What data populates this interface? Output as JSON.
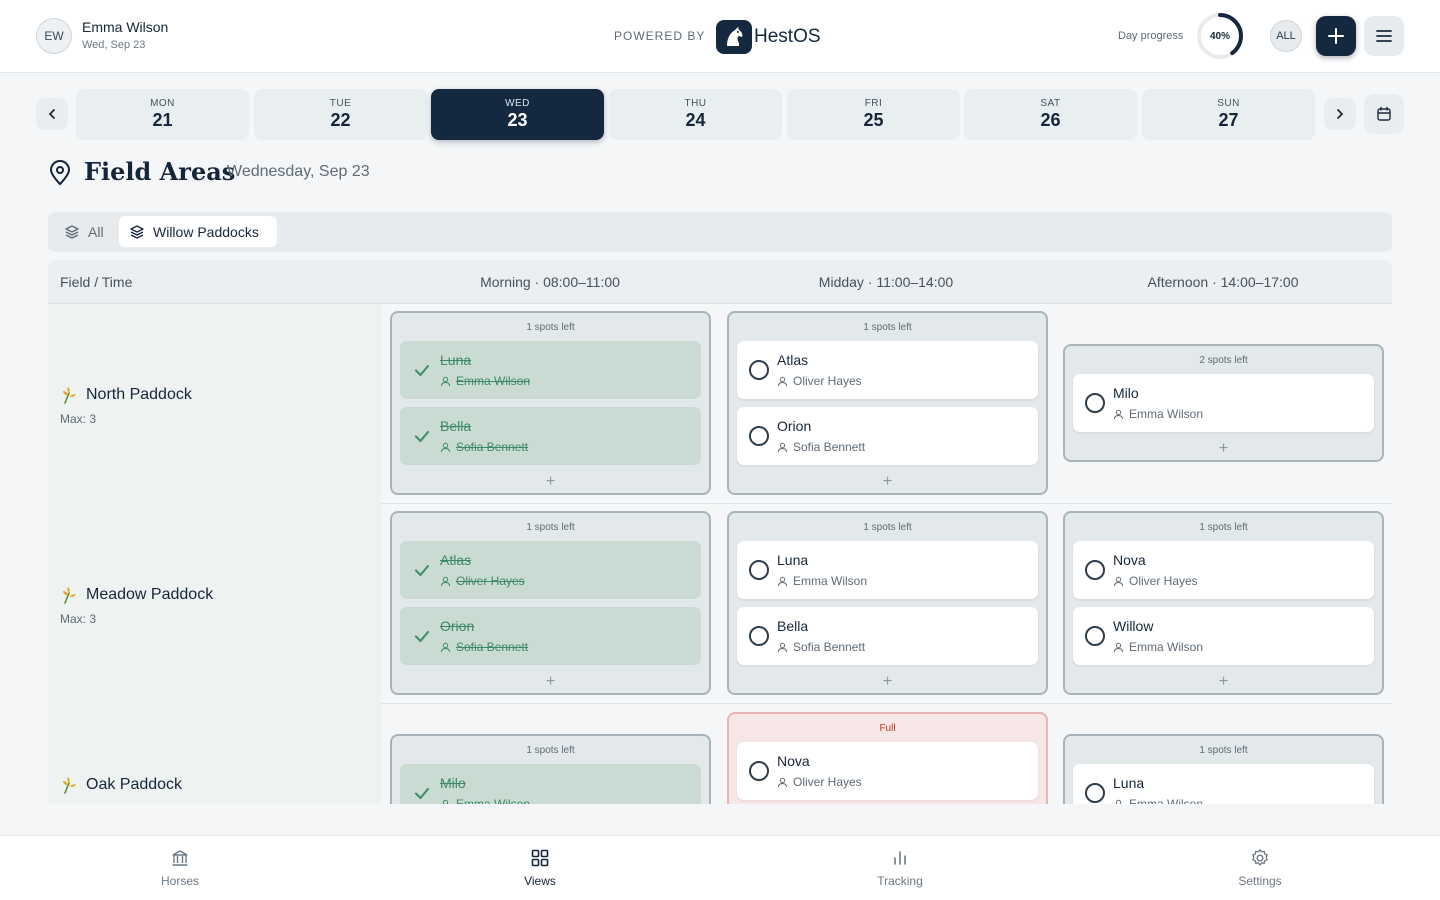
{
  "header": {
    "user_initials": "EW",
    "user_name": "Emma Wilson",
    "user_date": "Wed, Sep 23",
    "powered_by": "POWERED BY",
    "brand_name": "HestOS",
    "day_progress_label": "Day progress",
    "day_progress_value": 40,
    "day_progress_text": "40%",
    "all_label": "ALL"
  },
  "days": [
    {
      "name": "MON",
      "num": "21",
      "active": false
    },
    {
      "name": "TUE",
      "num": "22",
      "active": false
    },
    {
      "name": "WED",
      "num": "23",
      "active": true
    },
    {
      "name": "THU",
      "num": "24",
      "active": false
    },
    {
      "name": "FRI",
      "num": "25",
      "active": false
    },
    {
      "name": "SAT",
      "num": "26",
      "active": false
    },
    {
      "name": "SUN",
      "num": "27",
      "active": false
    }
  ],
  "page": {
    "title": "Field Areas",
    "date": "Wednesday, Sep 23"
  },
  "filters": {
    "all": "All",
    "selected": "Willow Paddocks"
  },
  "grid": {
    "field_header": "Field / Time",
    "slots": [
      "Morning · 08:00–11:00",
      "Midday · 11:00–14:00",
      "Afternoon · 14:00–17:00"
    ],
    "add_symbol": "+",
    "rows": [
      {
        "field": "North Paddock",
        "max": "Max: 3",
        "cells": [
          {
            "status": "1 spots left",
            "full": false,
            "entries": [
              {
                "horse": "Luna",
                "owner": "Emma Wilson",
                "done": true
              },
              {
                "horse": "Bella",
                "owner": "Sofia Bennett",
                "done": true
              }
            ]
          },
          {
            "status": "1 spots left",
            "full": false,
            "entries": [
              {
                "horse": "Atlas",
                "owner": "Oliver Hayes",
                "done": false
              },
              {
                "horse": "Orion",
                "owner": "Sofia Bennett",
                "done": false
              }
            ]
          },
          {
            "status": "2 spots left",
            "full": false,
            "entries": [
              {
                "horse": "Milo",
                "owner": "Emma Wilson",
                "done": false
              }
            ]
          }
        ]
      },
      {
        "field": "Meadow Paddock",
        "max": "Max: 3",
        "cells": [
          {
            "status": "1 spots left",
            "full": false,
            "entries": [
              {
                "horse": "Atlas",
                "owner": "Oliver Hayes",
                "done": true
              },
              {
                "horse": "Orion",
                "owner": "Sofia Bennett",
                "done": true
              }
            ]
          },
          {
            "status": "1 spots left",
            "full": false,
            "entries": [
              {
                "horse": "Luna",
                "owner": "Emma Wilson",
                "done": false
              },
              {
                "horse": "Bella",
                "owner": "Sofia Bennett",
                "done": false
              }
            ]
          },
          {
            "status": "1 spots left",
            "full": false,
            "entries": [
              {
                "horse": "Nova",
                "owner": "Oliver Hayes",
                "done": false
              },
              {
                "horse": "Willow",
                "owner": "Emma Wilson",
                "done": false
              }
            ]
          }
        ]
      },
      {
        "field": "Oak Paddock",
        "max": "",
        "cells": [
          {
            "status": "1 spots left",
            "full": false,
            "entries": [
              {
                "horse": "Milo",
                "owner": "Emma Wilson",
                "done": true
              }
            ]
          },
          {
            "status": "Full",
            "full": true,
            "entries": [
              {
                "horse": "Nova",
                "owner": "Oliver Hayes",
                "done": false
              }
            ]
          },
          {
            "status": "1 spots left",
            "full": false,
            "entries": [
              {
                "horse": "Luna",
                "owner": "Emma Wilson",
                "done": false
              }
            ]
          }
        ]
      }
    ]
  },
  "bottom_nav": [
    {
      "label": "Horses",
      "icon": "bank-icon",
      "active": false
    },
    {
      "label": "Views",
      "icon": "grid-icon",
      "active": true
    },
    {
      "label": "Tracking",
      "icon": "bar-chart-icon",
      "active": false
    },
    {
      "label": "Settings",
      "icon": "gear-icon",
      "active": false
    }
  ],
  "colors": {
    "primary": "#142840",
    "done_bg": "#c9dbd3",
    "done_text": "#3d8a66",
    "full_text": "#c0392b"
  }
}
